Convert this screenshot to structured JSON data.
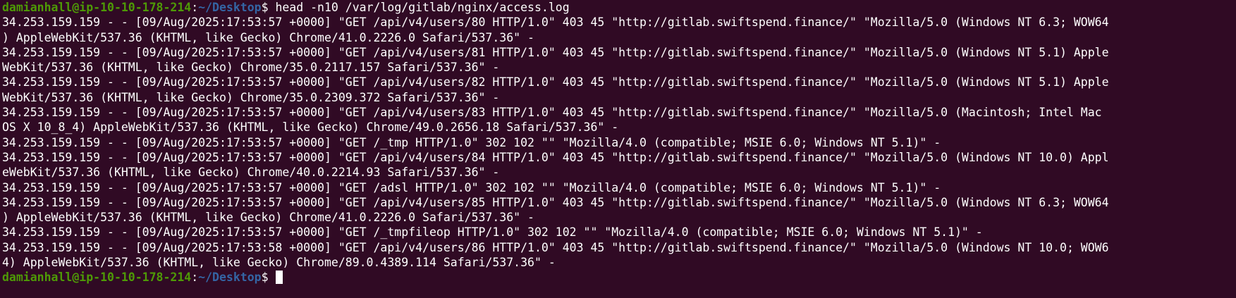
{
  "prompt": {
    "user_host": "damianhall@ip-10-10-178-214",
    "sep": ":",
    "path": "~/Desktop",
    "symbol": "$ "
  },
  "command": "head -n10 /var/log/gitlab/nginx/access.log",
  "output_lines": [
    "34.253.159.159 - - [09/Aug/2025:17:53:57 +0000] \"GET /api/v4/users/80 HTTP/1.0\" 403 45 \"http://gitlab.swiftspend.finance/\" \"Mozilla/5.0 (Windows NT 6.3; WOW64",
    ") AppleWebKit/537.36 (KHTML, like Gecko) Chrome/41.0.2226.0 Safari/537.36\" -",
    "34.253.159.159 - - [09/Aug/2025:17:53:57 +0000] \"GET /api/v4/users/81 HTTP/1.0\" 403 45 \"http://gitlab.swiftspend.finance/\" \"Mozilla/5.0 (Windows NT 5.1) Apple",
    "WebKit/537.36 (KHTML, like Gecko) Chrome/35.0.2117.157 Safari/537.36\" -",
    "34.253.159.159 - - [09/Aug/2025:17:53:57 +0000] \"GET /api/v4/users/82 HTTP/1.0\" 403 45 \"http://gitlab.swiftspend.finance/\" \"Mozilla/5.0 (Windows NT 5.1) Apple",
    "WebKit/537.36 (KHTML, like Gecko) Chrome/35.0.2309.372 Safari/537.36\" -",
    "34.253.159.159 - - [09/Aug/2025:17:53:57 +0000] \"GET /api/v4/users/83 HTTP/1.0\" 403 45 \"http://gitlab.swiftspend.finance/\" \"Mozilla/5.0 (Macintosh; Intel Mac",
    "OS X 10_8_4) AppleWebKit/537.36 (KHTML, like Gecko) Chrome/49.0.2656.18 Safari/537.36\" -",
    "34.253.159.159 - - [09/Aug/2025:17:53:57 +0000] \"GET /_tmp HTTP/1.0\" 302 102 \"\" \"Mozilla/4.0 (compatible; MSIE 6.0; Windows NT 5.1)\" -",
    "34.253.159.159 - - [09/Aug/2025:17:53:57 +0000] \"GET /api/v4/users/84 HTTP/1.0\" 403 45 \"http://gitlab.swiftspend.finance/\" \"Mozilla/5.0 (Windows NT 10.0) Appl",
    "eWebKit/537.36 (KHTML, like Gecko) Chrome/40.0.2214.93 Safari/537.36\" -",
    "34.253.159.159 - - [09/Aug/2025:17:53:57 +0000] \"GET /adsl HTTP/1.0\" 302 102 \"\" \"Mozilla/4.0 (compatible; MSIE 6.0; Windows NT 5.1)\" -",
    "34.253.159.159 - - [09/Aug/2025:17:53:57 +0000] \"GET /api/v4/users/85 HTTP/1.0\" 403 45 \"http://gitlab.swiftspend.finance/\" \"Mozilla/5.0 (Windows NT 6.3; WOW64",
    ") AppleWebKit/537.36 (KHTML, like Gecko) Chrome/41.0.2226.0 Safari/537.36\" -",
    "34.253.159.159 - - [09/Aug/2025:17:53:57 +0000] \"GET /_tmpfileop HTTP/1.0\" 302 102 \"\" \"Mozilla/4.0 (compatible; MSIE 6.0; Windows NT 5.1)\" -",
    "34.253.159.159 - - [09/Aug/2025:17:53:58 +0000] \"GET /api/v4/users/86 HTTP/1.0\" 403 45 \"http://gitlab.swiftspend.finance/\" \"Mozilla/5.0 (Windows NT 10.0; WOW6",
    "4) AppleWebKit/537.36 (KHTML, like Gecko) Chrome/89.0.4389.114 Safari/537.36\" -"
  ],
  "colors": {
    "background": "#300a24",
    "text": "#ffffff",
    "prompt_user_host": "#4e9a06",
    "prompt_path": "#3465a4"
  }
}
